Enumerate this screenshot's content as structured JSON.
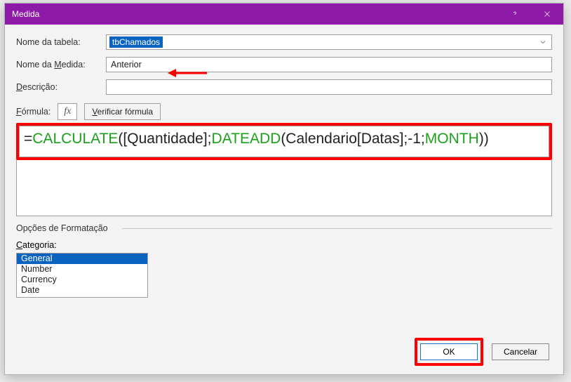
{
  "title": "Medida",
  "labels": {
    "table": "Nome da tabela:",
    "measure_pre": "Nome da ",
    "measure_u": "M",
    "measure_post": "edida:",
    "desc_u": "D",
    "desc_post": "escrição:",
    "formula_u": "F",
    "formula_post": "órmula:",
    "verify_u": "V",
    "verify_post": "erificar fórmula",
    "fmt_options": "Opções de Formatação",
    "category_u": "C",
    "category_post": "ategoria:"
  },
  "fields": {
    "table_value": "tbChamados",
    "measure_value": "Anterior",
    "description_value": ""
  },
  "formula": {
    "eq": "=",
    "t1_fn": "CALCULATE",
    "t2": "([Quantidade];",
    "t3_fn": "DATEADD",
    "t4": "(Calendario[Datas];-1;",
    "t5_fn": "MONTH",
    "t6": "))"
  },
  "categories": [
    "General",
    "Number",
    "Currency",
    "Date"
  ],
  "selected_category_index": 0,
  "buttons": {
    "ok": "OK",
    "cancel": "Cancelar"
  },
  "fx_label": "fx"
}
